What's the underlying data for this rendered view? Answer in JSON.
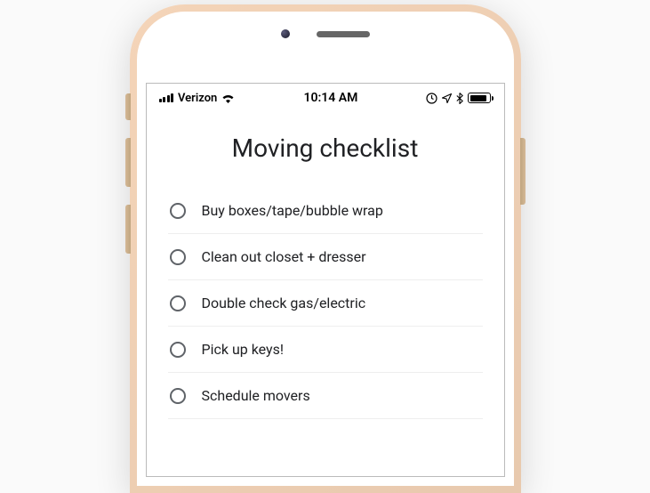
{
  "status_bar": {
    "carrier": "Verizon",
    "time": "10:14 AM"
  },
  "page": {
    "title": "Moving checklist"
  },
  "checklist": {
    "items": [
      {
        "label": "Buy boxes/tape/bubble wrap",
        "checked": false
      },
      {
        "label": "Clean out closet + dresser",
        "checked": false
      },
      {
        "label": "Double check gas/electric",
        "checked": false
      },
      {
        "label": "Pick up keys!",
        "checked": false
      },
      {
        "label": "Schedule movers",
        "checked": false
      }
    ]
  }
}
